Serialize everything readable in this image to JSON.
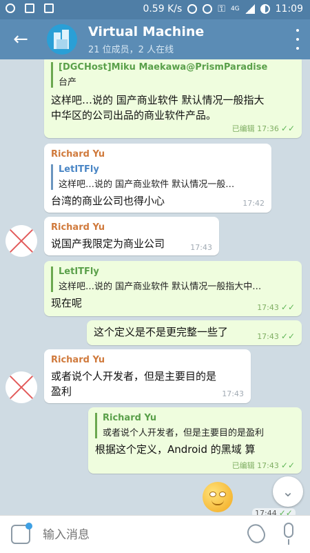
{
  "status_bar": {
    "speed": "0.59 K/s",
    "network": "4G",
    "time": "11:09"
  },
  "header": {
    "title": "Virtual Machine",
    "subtitle": "21 位成员，2 人在线"
  },
  "messages": [
    {
      "id": "m1",
      "direction": "out",
      "quote_author": "[DGCHost]Miku Maekawa@PrismParadise",
      "quote_text": "台产",
      "text_line1": "这样吧…说的 国产商业软件 默认情况一般指大",
      "text_line2": "中华区的公司出品的商业软件产品。",
      "meta": "已编辑 17:36"
    },
    {
      "id": "m2",
      "direction": "in",
      "author": "Richard Yu",
      "quote_author": "LetITFly",
      "quote_text": "这样吧…说的 国产商业软件 默认情况一般…",
      "text": "台湾的商业公司也得小心",
      "meta": "17:42"
    },
    {
      "id": "m3",
      "direction": "in",
      "author": "Richard Yu",
      "text": "说国产我限定为商业公司",
      "meta": "17:43"
    },
    {
      "id": "m4",
      "direction": "out",
      "quote_author": "LetITFly",
      "quote_text": "这样吧…说的 国产商业软件 默认情况一般指大中…",
      "text": "现在呢",
      "meta": "17:43"
    },
    {
      "id": "m5",
      "direction": "out",
      "text": "这个定义是不是更完整一些了",
      "meta": "17:43"
    },
    {
      "id": "m6",
      "direction": "in",
      "author": "Richard Yu",
      "text_line1": "或者说个人开发者，但是主要目的是",
      "text_line2": "盈利",
      "meta": "17:43"
    },
    {
      "id": "m7",
      "direction": "out",
      "quote_author": "Richard Yu",
      "quote_text": "或者说个人开发者，但是主要目的是盈利",
      "text": "根据这个定义，Android 的黑域 算",
      "meta": "已编辑 17:43"
    },
    {
      "id": "m8",
      "direction": "out",
      "meta": "17:44"
    }
  ],
  "input": {
    "placeholder": "输入消息"
  },
  "colors": {
    "header_bg": "#5b8cb5",
    "status_bg": "#4f7ea6",
    "out_bubble": "#effdde",
    "in_bubble": "#ffffff",
    "author_name": "#d07a3c",
    "accent_green": "#5aa04a",
    "accent_blue": "#4a86c5"
  }
}
